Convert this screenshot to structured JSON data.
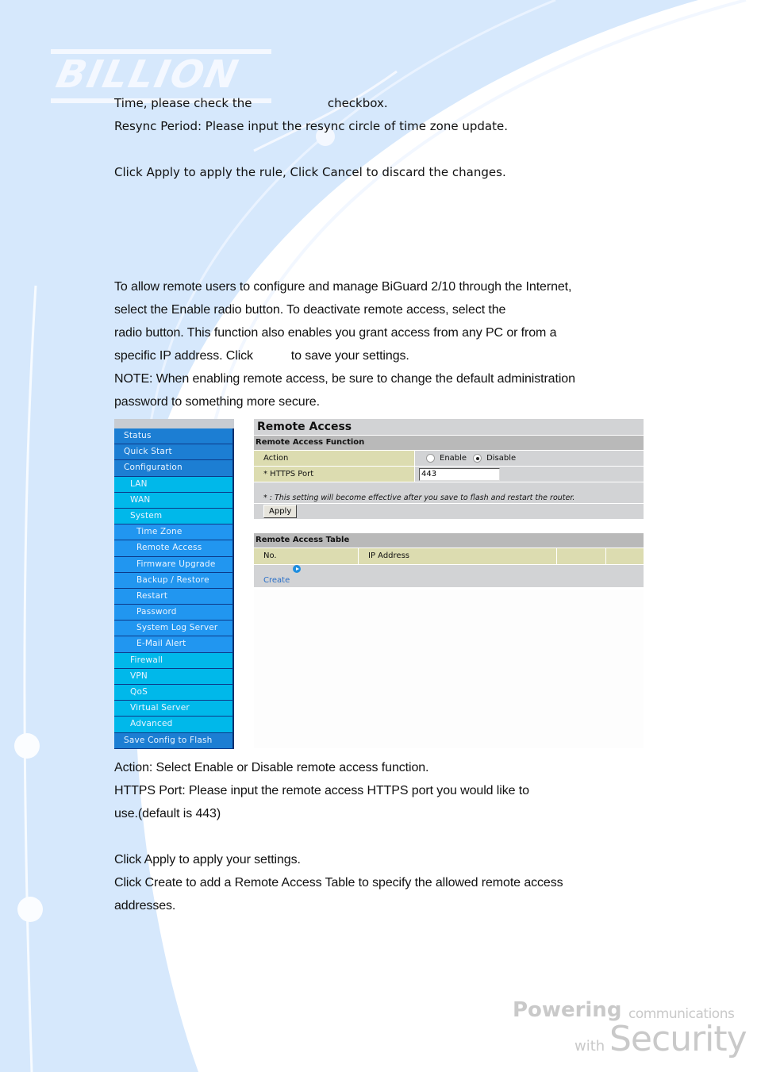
{
  "brand": {
    "logo_text": "BILLION",
    "tagline_powering": "Powering",
    "tagline_communications": "communications",
    "tagline_with": "with",
    "tagline_security": "Security"
  },
  "colors": {
    "background_blue": "#d6e8fc",
    "nav_level0": "#1c7ed3",
    "nav_level1": "#00b8ea",
    "nav_level2": "#2196f0",
    "panel_gray": "#d2d3d5",
    "section_gray": "#b9b9b9",
    "label_khaki": "#dcdcb0",
    "link_blue": "#2a6fc7"
  },
  "intro_text": {
    "lines": [
      "Time, please check the                    checkbox.",
      "Resync Period: Please input the resync circle of time zone update.",
      "",
      "Click Apply to apply the rule, Click Cancel to discard the changes."
    ]
  },
  "remote_access_text": {
    "lines": [
      "To allow remote users to configure and manage BiGuard 2/10 through the Internet,",
      "select the Enable radio button. To deactivate remote access, select the",
      "radio button. This function also enables you grant access from any PC or from a",
      "specific IP address. Click           to save your settings.",
      "NOTE: When enabling remote access, be sure to change the default administration",
      "password to something more secure."
    ]
  },
  "nav": {
    "items": [
      {
        "label": "Status",
        "level": 0
      },
      {
        "label": "Quick Start",
        "level": 0
      },
      {
        "label": "Configuration",
        "level": 0
      },
      {
        "label": "LAN",
        "level": 1
      },
      {
        "label": "WAN",
        "level": 1
      },
      {
        "label": "System",
        "level": 1
      },
      {
        "label": "Time Zone",
        "level": 2
      },
      {
        "label": "Remote Access",
        "level": 2
      },
      {
        "label": "Firmware Upgrade",
        "level": 2
      },
      {
        "label": "Backup / Restore",
        "level": 2
      },
      {
        "label": "Restart",
        "level": 2
      },
      {
        "label": "Password",
        "level": 2
      },
      {
        "label": "System Log Server",
        "level": 2
      },
      {
        "label": "E-Mail Alert",
        "level": 2
      },
      {
        "label": "Firewall",
        "level": 1
      },
      {
        "label": "VPN",
        "level": 1
      },
      {
        "label": "QoS",
        "level": 1
      },
      {
        "label": "Virtual Server",
        "level": 1
      },
      {
        "label": "Advanced",
        "level": 1
      },
      {
        "label": "Save Config to Flash",
        "level": 0
      }
    ]
  },
  "panel": {
    "title": "Remote Access",
    "function_section": "Remote Access Function",
    "action_label": "Action",
    "action_options": [
      "Enable",
      "Disable"
    ],
    "action_selected": "Disable",
    "https_port_label": "* HTTPS Port",
    "https_port_value": "443",
    "note": "* : This setting will become effective after you save to flash and restart the router.",
    "apply_label": "Apply",
    "table_section": "Remote Access Table",
    "table_columns": [
      "No.",
      "IP Address",
      "",
      ""
    ],
    "create_label": "Create"
  },
  "description_text": {
    "lines": [
      "Action: Select Enable or Disable remote access function.",
      "HTTPS Port: Please input the remote access HTTPS port you would like to",
      "use.(default is 443)",
      "",
      "Click Apply to apply your settings.",
      "Click Create to add a Remote Access Table to specify the allowed remote access",
      "addresses."
    ]
  }
}
